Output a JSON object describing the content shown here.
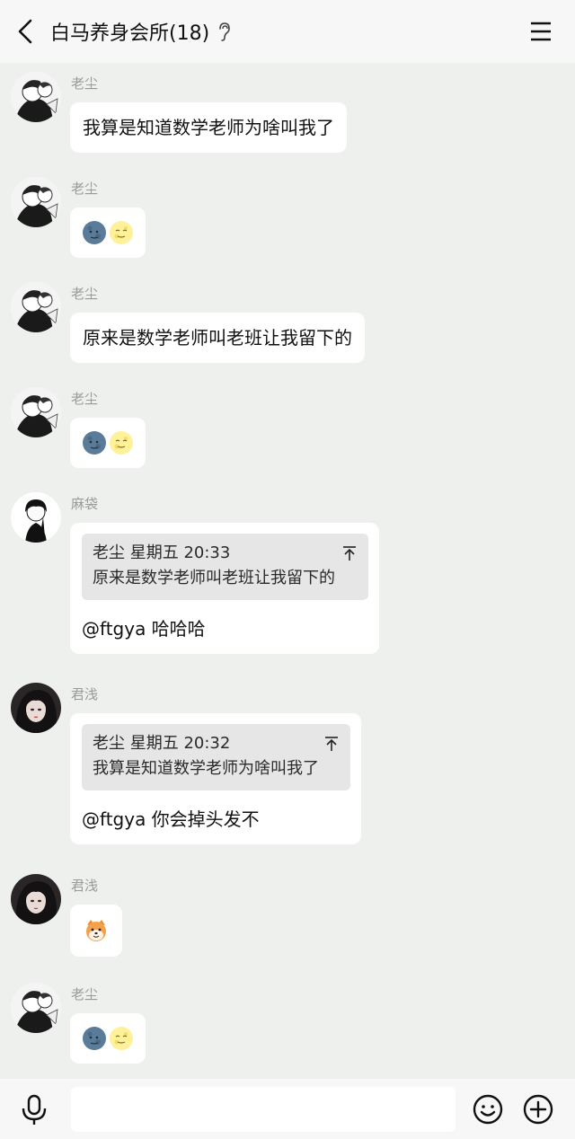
{
  "header": {
    "title": "白马养身会所(18)",
    "back_icon": "chevron-left-icon",
    "ear_icon": "ear-icon",
    "menu_icon": "hamburger-menu-icon"
  },
  "messages": [
    {
      "sender": "老尘",
      "text": "我算是知道数学老师为啥叫我了"
    },
    {
      "sender": "老尘",
      "emojis": [
        "new-moon-face",
        "full-moon-face"
      ]
    },
    {
      "sender": "老尘",
      "text": "原来是数学老师叫老班让我留下的"
    },
    {
      "sender": "老尘",
      "emojis": [
        "new-moon-face",
        "full-moon-face"
      ]
    },
    {
      "sender": "麻袋",
      "quote": {
        "meta": "老尘 星期五 20:33",
        "text": "原来是数学老师叫老班让我留下的"
      },
      "text": "@ftgya 哈哈哈"
    },
    {
      "sender": "君浅",
      "quote": {
        "meta": "老尘 星期五 20:32",
        "text": "我算是知道数学老师为啥叫我了"
      },
      "text": "@ftgya 你会掉头发不"
    },
    {
      "sender": "君浅",
      "emojis": [
        "shiba-dog-face"
      ]
    },
    {
      "sender": "老尘",
      "emojis": [
        "new-moon-face",
        "full-moon-face"
      ]
    }
  ],
  "footer": {
    "mic_icon": "microphone-icon",
    "input_value": "",
    "emoji_icon": "smiley-icon",
    "plus_icon": "plus-circle-icon"
  },
  "colors": {
    "chat_background": "#edf0ed",
    "bubble": "#ffffff",
    "quote_background": "#e6e6e6",
    "sender_name": "#9a9a9a"
  }
}
